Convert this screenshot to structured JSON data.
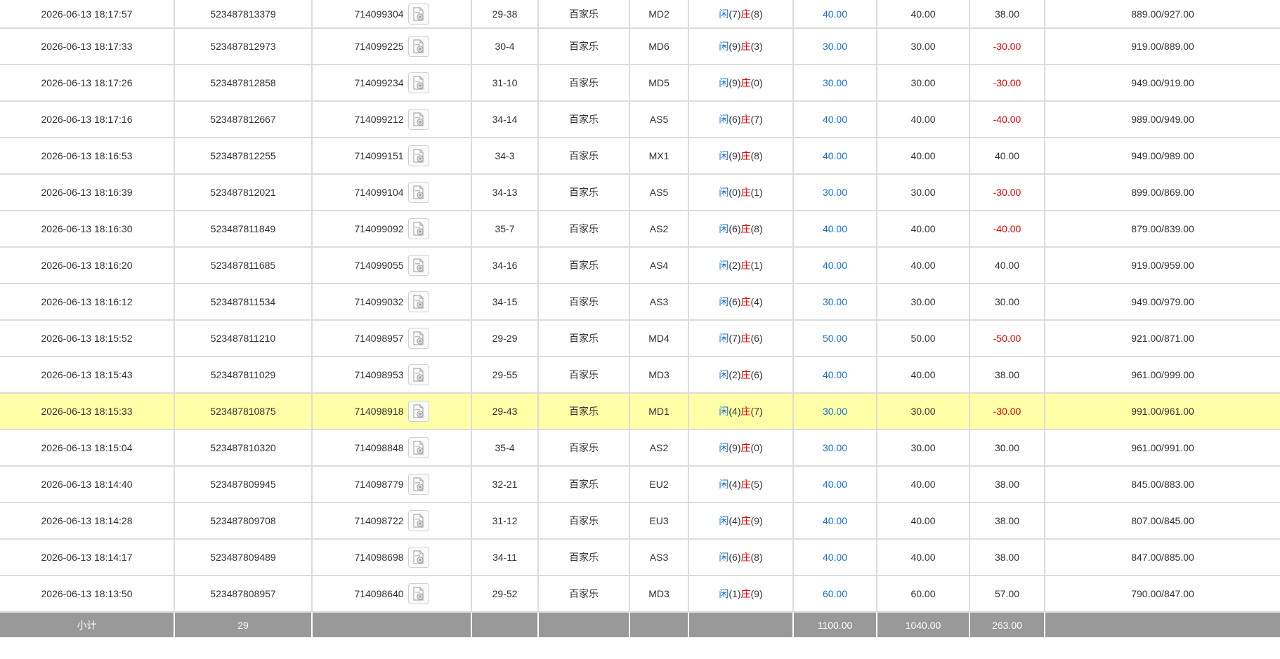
{
  "colors": {
    "blue": "#1a6fd6",
    "red": "#e60000",
    "highlight": "#ffffa8",
    "subtotal_bg": "#999999"
  },
  "detail_icon": "document-chips-icon",
  "player_label": "闲",
  "banker_label": "庄",
  "rows": [
    {
      "time": "2026-06-13 18:17:57",
      "order_id": "523487813379",
      "round_id": "714099304",
      "shoe": "29-38",
      "game": "百家乐",
      "table": "MD2",
      "player": "(7)",
      "banker": "(8)",
      "bet": "40.00",
      "valid": "40.00",
      "win": "38.00",
      "win_neg": false,
      "balance": "889.00/927.00",
      "highlight": false
    },
    {
      "time": "2026-06-13 18:17:33",
      "order_id": "523487812973",
      "round_id": "714099225",
      "shoe": "30-4",
      "game": "百家乐",
      "table": "MD6",
      "player": "(9)",
      "banker": "(3)",
      "bet": "30.00",
      "valid": "30.00",
      "win": "-30.00",
      "win_neg": true,
      "balance": "919.00/889.00",
      "highlight": false
    },
    {
      "time": "2026-06-13 18:17:26",
      "order_id": "523487812858",
      "round_id": "714099234",
      "shoe": "31-10",
      "game": "百家乐",
      "table": "MD5",
      "player": "(9)",
      "banker": "(0)",
      "bet": "30.00",
      "valid": "30.00",
      "win": "-30.00",
      "win_neg": true,
      "balance": "949.00/919.00",
      "highlight": false
    },
    {
      "time": "2026-06-13 18:17:16",
      "order_id": "523487812667",
      "round_id": "714099212",
      "shoe": "34-14",
      "game": "百家乐",
      "table": "AS5",
      "player": "(6)",
      "banker": "(7)",
      "bet": "40.00",
      "valid": "40.00",
      "win": "-40.00",
      "win_neg": true,
      "balance": "989.00/949.00",
      "highlight": false
    },
    {
      "time": "2026-06-13 18:16:53",
      "order_id": "523487812255",
      "round_id": "714099151",
      "shoe": "34-3",
      "game": "百家乐",
      "table": "MX1",
      "player": "(9)",
      "banker": "(8)",
      "bet": "40.00",
      "valid": "40.00",
      "win": "40.00",
      "win_neg": false,
      "balance": "949.00/989.00",
      "highlight": false
    },
    {
      "time": "2026-06-13 18:16:39",
      "order_id": "523487812021",
      "round_id": "714099104",
      "shoe": "34-13",
      "game": "百家乐",
      "table": "AS5",
      "player": "(0)",
      "banker": "(1)",
      "bet": "30.00",
      "valid": "30.00",
      "win": "-30.00",
      "win_neg": true,
      "balance": "899.00/869.00",
      "highlight": false
    },
    {
      "time": "2026-06-13 18:16:30",
      "order_id": "523487811849",
      "round_id": "714099092",
      "shoe": "35-7",
      "game": "百家乐",
      "table": "AS2",
      "player": "(6)",
      "banker": "(8)",
      "bet": "40.00",
      "valid": "40.00",
      "win": "-40.00",
      "win_neg": true,
      "balance": "879.00/839.00",
      "highlight": false
    },
    {
      "time": "2026-06-13 18:16:20",
      "order_id": "523487811685",
      "round_id": "714099055",
      "shoe": "34-16",
      "game": "百家乐",
      "table": "AS4",
      "player": "(2)",
      "banker": "(1)",
      "bet": "40.00",
      "valid": "40.00",
      "win": "40.00",
      "win_neg": false,
      "balance": "919.00/959.00",
      "highlight": false
    },
    {
      "time": "2026-06-13 18:16:12",
      "order_id": "523487811534",
      "round_id": "714099032",
      "shoe": "34-15",
      "game": "百家乐",
      "table": "AS3",
      "player": "(6)",
      "banker": "(4)",
      "bet": "30.00",
      "valid": "30.00",
      "win": "30.00",
      "win_neg": false,
      "balance": "949.00/979.00",
      "highlight": false
    },
    {
      "time": "2026-06-13 18:15:52",
      "order_id": "523487811210",
      "round_id": "714098957",
      "shoe": "29-29",
      "game": "百家乐",
      "table": "MD4",
      "player": "(7)",
      "banker": "(6)",
      "bet": "50.00",
      "valid": "50.00",
      "win": "-50.00",
      "win_neg": true,
      "balance": "921.00/871.00",
      "highlight": false
    },
    {
      "time": "2026-06-13 18:15:43",
      "order_id": "523487811029",
      "round_id": "714098953",
      "shoe": "29-55",
      "game": "百家乐",
      "table": "MD3",
      "player": "(2)",
      "banker": "(6)",
      "bet": "40.00",
      "valid": "40.00",
      "win": "38.00",
      "win_neg": false,
      "balance": "961.00/999.00",
      "highlight": false
    },
    {
      "time": "2026-06-13 18:15:33",
      "order_id": "523487810875",
      "round_id": "714098918",
      "shoe": "29-43",
      "game": "百家乐",
      "table": "MD1",
      "player": "(4)",
      "banker": "(7)",
      "bet": "30.00",
      "valid": "30.00",
      "win": "-30.00",
      "win_neg": true,
      "balance": "991.00/961.00",
      "highlight": true
    },
    {
      "time": "2026-06-13 18:15:04",
      "order_id": "523487810320",
      "round_id": "714098848",
      "shoe": "35-4",
      "game": "百家乐",
      "table": "AS2",
      "player": "(9)",
      "banker": "(0)",
      "bet": "30.00",
      "valid": "30.00",
      "win": "30.00",
      "win_neg": false,
      "balance": "961.00/991.00",
      "highlight": false
    },
    {
      "time": "2026-06-13 18:14:40",
      "order_id": "523487809945",
      "round_id": "714098779",
      "shoe": "32-21",
      "game": "百家乐",
      "table": "EU2",
      "player": "(4)",
      "banker": "(5)",
      "bet": "40.00",
      "valid": "40.00",
      "win": "38.00",
      "win_neg": false,
      "balance": "845.00/883.00",
      "highlight": false
    },
    {
      "time": "2026-06-13 18:14:28",
      "order_id": "523487809708",
      "round_id": "714098722",
      "shoe": "31-12",
      "game": "百家乐",
      "table": "EU3",
      "player": "(4)",
      "banker": "(9)",
      "bet": "40.00",
      "valid": "40.00",
      "win": "38.00",
      "win_neg": false,
      "balance": "807.00/845.00",
      "highlight": false
    },
    {
      "time": "2026-06-13 18:14:17",
      "order_id": "523487809489",
      "round_id": "714098698",
      "shoe": "34-11",
      "game": "百家乐",
      "table": "AS3",
      "player": "(6)",
      "banker": "(8)",
      "bet": "40.00",
      "valid": "40.00",
      "win": "38.00",
      "win_neg": false,
      "balance": "847.00/885.00",
      "highlight": false
    },
    {
      "time": "2026-06-13 18:13:50",
      "order_id": "523487808957",
      "round_id": "714098640",
      "shoe": "29-52",
      "game": "百家乐",
      "table": "MD3",
      "player": "(1)",
      "banker": "(9)",
      "bet": "60.00",
      "valid": "60.00",
      "win": "57.00",
      "win_neg": false,
      "balance": "790.00/847.00",
      "highlight": false
    }
  ],
  "subtotal": {
    "label": "小计",
    "count": "29",
    "bet": "1100.00",
    "valid": "1040.00",
    "win": "263.00"
  }
}
